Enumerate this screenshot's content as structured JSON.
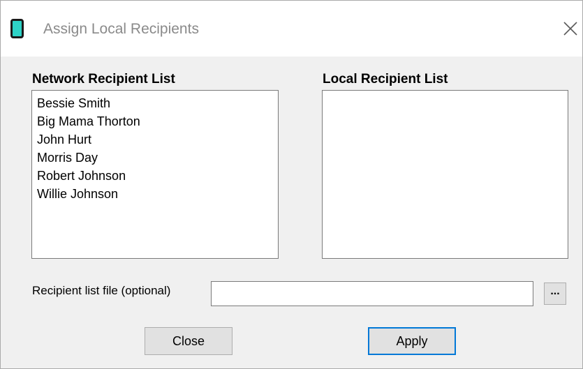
{
  "window": {
    "title": "Assign Local Recipients",
    "app_icon": "device-icon",
    "close_icon": "close-icon"
  },
  "network_list": {
    "label": "Network Recipient List",
    "items": [
      {
        "label": "Bessie Smith"
      },
      {
        "label": "Big Mama Thorton"
      },
      {
        "label": "John Hurt"
      },
      {
        "label": "Morris Day"
      },
      {
        "label": "Robert Johnson"
      },
      {
        "label": "Willie Johnson"
      }
    ]
  },
  "local_list": {
    "label": "Local Recipient List",
    "items": []
  },
  "file": {
    "label": "Recipient list file (optional)",
    "value": "",
    "placeholder": "",
    "browse_label": "..."
  },
  "buttons": {
    "close_label": "Close",
    "apply_label": "Apply"
  },
  "colors": {
    "accent": "#0078d7",
    "icon_fill": "#2ed3c7",
    "title_text": "#8a8a8a",
    "dialog_bg": "#f0f0f0"
  }
}
